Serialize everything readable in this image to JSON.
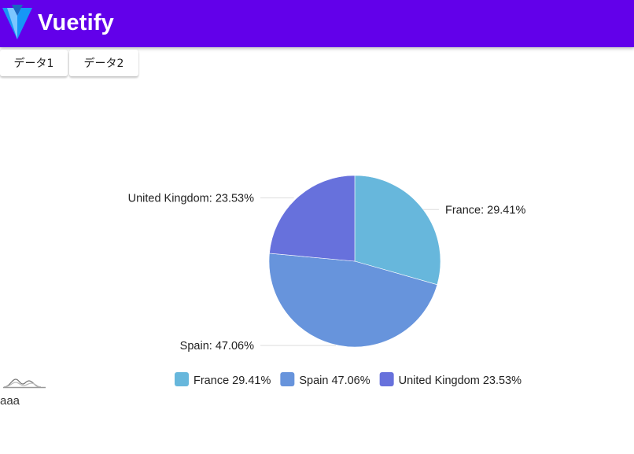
{
  "app": {
    "title": "Vuetify"
  },
  "toolbar": {
    "buttons": [
      "データ1",
      "データ2"
    ]
  },
  "colors": {
    "appbar": "#6200ea",
    "france": "#67b7dc",
    "spain": "#6794dc",
    "uk": "#6771dc"
  },
  "chart_data": {
    "type": "pie",
    "categories": [
      "France",
      "Spain",
      "United Kingdom"
    ],
    "values": [
      29.41,
      47.06,
      23.53
    ],
    "labels": [
      "France: 29.41%",
      "Spain: 47.06%",
      "United Kingdom: 23.53%"
    ],
    "legend": [
      "France 29.41%",
      "Spain 47.06%",
      "United Kingdom 23.53%"
    ],
    "legend_position": "bottom"
  },
  "footer": {
    "sparkline_icon": "sparkline-icon",
    "caption": "aaa"
  }
}
